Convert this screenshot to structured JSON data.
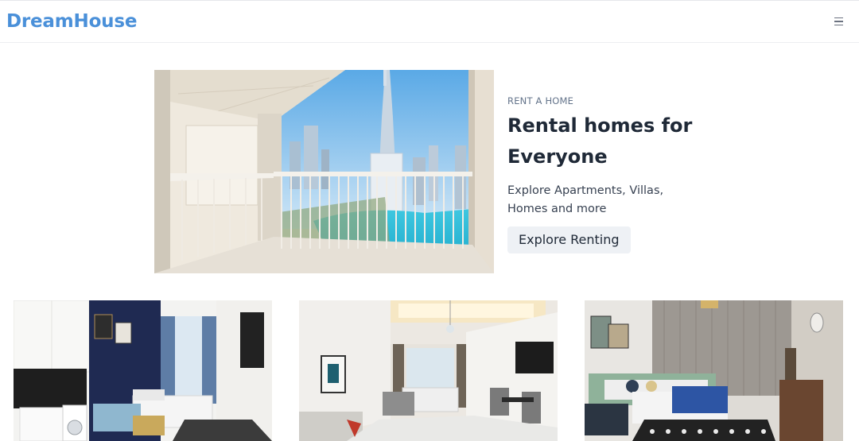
{
  "navbar": {
    "brand": "DreamHouse",
    "menu_icon": "hamburger-menu-icon"
  },
  "hero": {
    "eyebrow": "RENT A HOME",
    "title": "Rental homes for Everyone",
    "description": "Explore Apartments, Villas, Homes and more",
    "cta_label": "Explore Renting",
    "image": "balcony-city-view-photo"
  },
  "listings": [
    {
      "image": "studio-apartment-photo"
    },
    {
      "image": "bedroom-living-photo"
    },
    {
      "image": "bedroom-dressing-photo"
    }
  ],
  "colors": {
    "brand": "#4a90d9",
    "cta_bg": "#eef1f5",
    "text": "#1f2937"
  }
}
